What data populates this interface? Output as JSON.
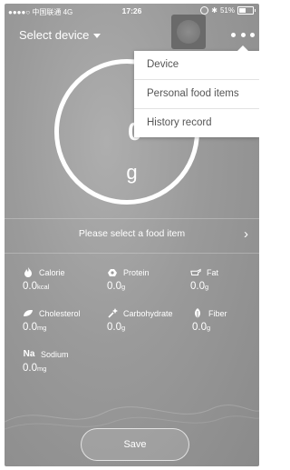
{
  "statusbar": {
    "carrier": "●●●●○ 中国联通  4G",
    "time": "17:26",
    "battery": "51%"
  },
  "header": {
    "device_select_label": "Select device"
  },
  "scale": {
    "value": "0",
    "unit": "g"
  },
  "menu": {
    "items": [
      {
        "label": "Device"
      },
      {
        "label": "Personal food items"
      },
      {
        "label": "History record"
      }
    ]
  },
  "food": {
    "prompt": "Please select a food item"
  },
  "nutrients": [
    {
      "name": "Calorie",
      "value": "0.0",
      "unit": "kcal",
      "icon": "flame-icon"
    },
    {
      "name": "Protein",
      "value": "0.0",
      "unit": "g",
      "icon": "egg-icon"
    },
    {
      "name": "Fat",
      "value": "0.0",
      "unit": "g",
      "icon": "oil-icon"
    },
    {
      "name": "Cholesterol",
      "value": "0.0",
      "unit": "mg",
      "icon": "leaf-icon"
    },
    {
      "name": "Carbohydrate",
      "value": "0.0",
      "unit": "g",
      "icon": "sparkle-icon"
    },
    {
      "name": "Fiber",
      "value": "0.0",
      "unit": "g",
      "icon": "plant-icon"
    },
    {
      "name": "Sodium",
      "value": "0.0",
      "unit": "mg",
      "icon": "Na"
    }
  ],
  "actions": {
    "save_label": "Save"
  }
}
